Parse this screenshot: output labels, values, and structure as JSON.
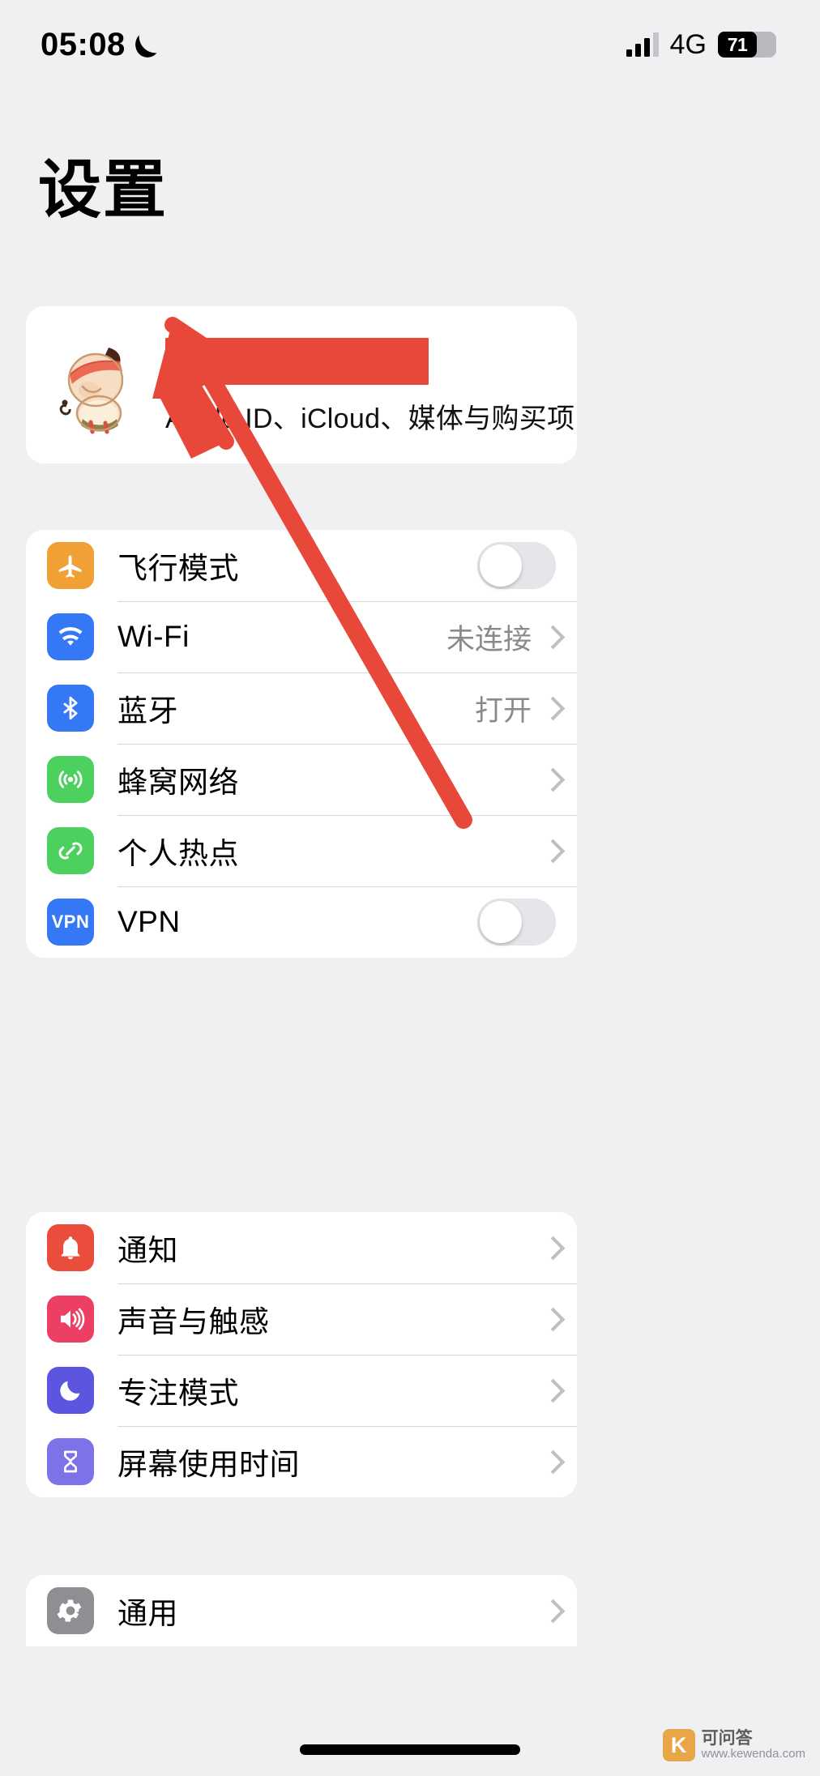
{
  "statusbar": {
    "time": "05:08",
    "moon_icon": "crescent-moon-icon",
    "network": "4G",
    "battery_percent": "71",
    "signal_icon": "cellular-signal-icon"
  },
  "header": {
    "title": "设置"
  },
  "apple_id": {
    "avatar_icon": "cartoon-baby-avatar",
    "name_redacted": true,
    "redaction_color": "#e8483a",
    "subtitle": "Apple ID、iCloud、媒体与购买项目",
    "chevron_icon": "chevron-right-icon"
  },
  "annotation": {
    "arrow_color": "#e8483a",
    "arrow_points_to": "apple-id-row"
  },
  "groups": [
    {
      "id": "connectivity",
      "rows": [
        {
          "label": "飞行模式",
          "icon": "airplane-icon",
          "icon_color": "#f0a035",
          "accessory": "switch",
          "switch_on": false
        },
        {
          "label": "Wi-Fi",
          "icon": "wifi-icon",
          "icon_color": "#3478f6",
          "accessory": "chevron",
          "value": "未连接"
        },
        {
          "label": "蓝牙",
          "icon": "bluetooth-icon",
          "icon_color": "#3478f6",
          "accessory": "chevron",
          "value": "打开"
        },
        {
          "label": "蜂窝网络",
          "icon": "cellular-icon",
          "icon_color": "#4cd15f",
          "accessory": "chevron",
          "value": ""
        },
        {
          "label": "个人热点",
          "icon": "hotspot-icon",
          "icon_color": "#4cd15f",
          "accessory": "chevron",
          "value": ""
        },
        {
          "label": "VPN",
          "icon": "vpn-icon",
          "icon_color": "#3478f6",
          "accessory": "switch",
          "switch_on": false
        }
      ]
    },
    {
      "id": "alerts",
      "rows": [
        {
          "label": "通知",
          "icon": "bell-icon",
          "icon_color": "#eb4d3d",
          "accessory": "chevron",
          "value": ""
        },
        {
          "label": "声音与触感",
          "icon": "speaker-icon",
          "icon_color": "#ec3f63",
          "accessory": "chevron",
          "value": ""
        },
        {
          "label": "专注模式",
          "icon": "moon-focus-icon",
          "icon_color": "#5b55e0",
          "accessory": "chevron",
          "value": ""
        },
        {
          "label": "屏幕使用时间",
          "icon": "hourglass-icon",
          "icon_color": "#7d72e8",
          "accessory": "chevron",
          "value": ""
        }
      ]
    },
    {
      "id": "system",
      "rows": [
        {
          "label": "通用",
          "icon": "gear-icon",
          "icon_color": "#8e8e93",
          "accessory": "chevron",
          "value": ""
        }
      ]
    }
  ],
  "watermark": {
    "badge": "K",
    "main": "可问答",
    "sub": "www.kewenda.com"
  }
}
